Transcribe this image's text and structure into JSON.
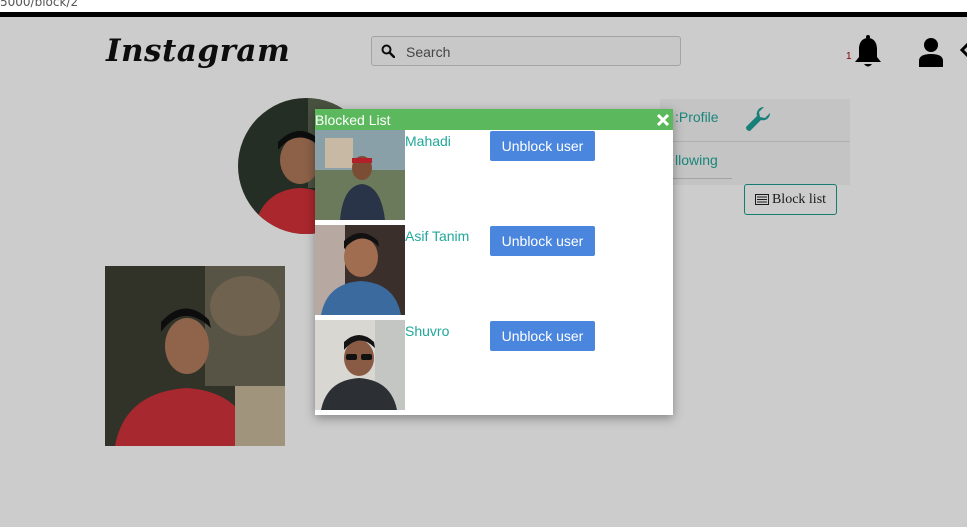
{
  "browser": {
    "url_fragment": "5000/block/2"
  },
  "header": {
    "logo": "Instagram",
    "search_placeholder": "Search",
    "notification_count": "1"
  },
  "profile": {
    "tab_profile": ":Profile",
    "tab_following": "llowing",
    "block_list_button": "Block list"
  },
  "modal": {
    "title": "Blocked List",
    "close_icon": "close-icon",
    "users": [
      {
        "name": "Mahadi",
        "action": "Unblock user"
      },
      {
        "name": "Asif Tanim",
        "action": "Unblock user"
      },
      {
        "name": "Shuvro",
        "action": "Unblock user"
      }
    ]
  },
  "colors": {
    "modal_header": "#5cb85c",
    "link_teal": "#20a89a",
    "unblock_button": "#4a85de",
    "notification_red": "#a00000"
  },
  "icons": [
    "search-icon",
    "bell-icon",
    "user-icon",
    "wrench-icon",
    "list-icon",
    "close-icon"
  ]
}
